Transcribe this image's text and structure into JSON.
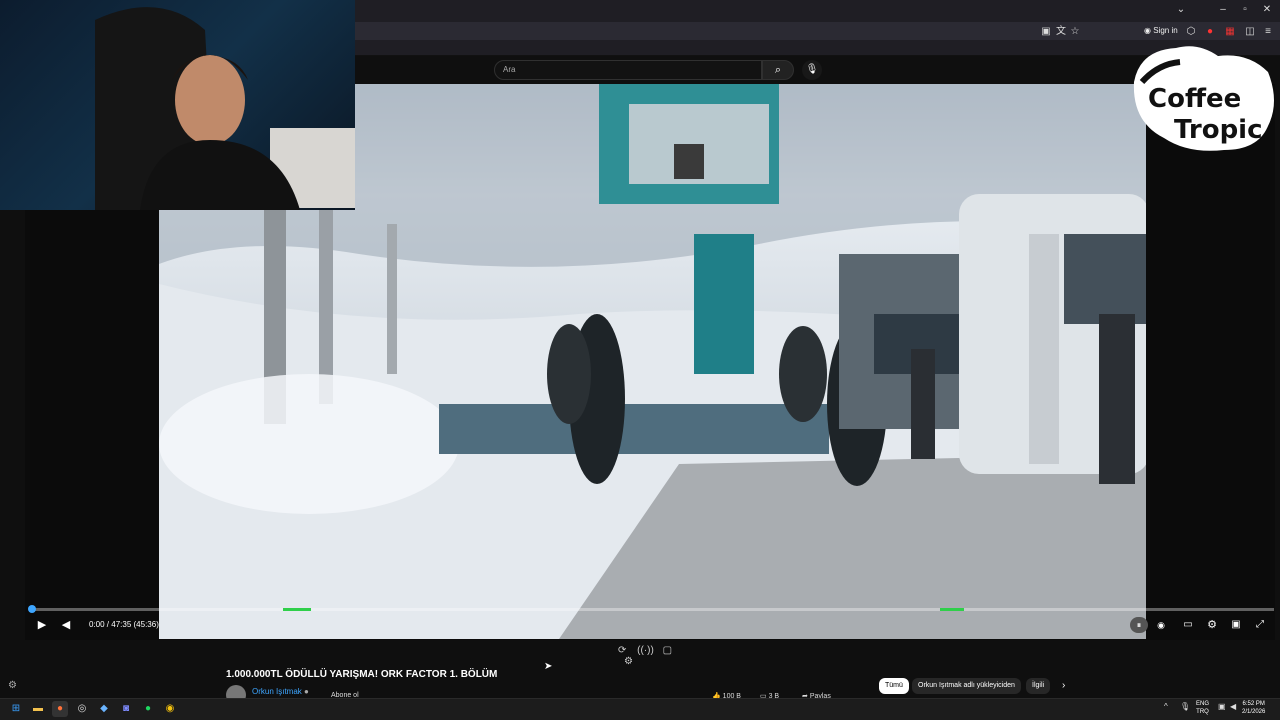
{
  "browser": {
    "sign_in": "Sign in",
    "window_controls": [
      "chevron-down-icon",
      "minimize-icon",
      "restore-icon",
      "close-icon"
    ]
  },
  "youtube": {
    "search_placeholder": "Ara"
  },
  "overlay_logo": {
    "line1": "Coffee",
    "line2": "Tropic"
  },
  "player": {
    "time_current": "0:00",
    "time_separator": " / ",
    "time_total": "47:35",
    "time_chapter": "(45:36)",
    "progress": 0.0
  },
  "video_info": {
    "title": "1.000.000TL ÖDÜLLÜ YARIŞMA! ORK FACTOR 1. BÖLÜM",
    "channel": "Orkun Işıtmak",
    "subscribe": "Abone ol",
    "likes": "100 B",
    "comments": "3 B",
    "share": "Paylaş"
  },
  "chips": [
    "Tümü",
    "Orkun Işıtmak adlı yükleyiciden",
    "İlgili"
  ],
  "taskbar": {
    "lang_top": "ENG",
    "lang_bottom": "TRQ",
    "time": "6:52 PM",
    "date": "2/1/2026"
  }
}
